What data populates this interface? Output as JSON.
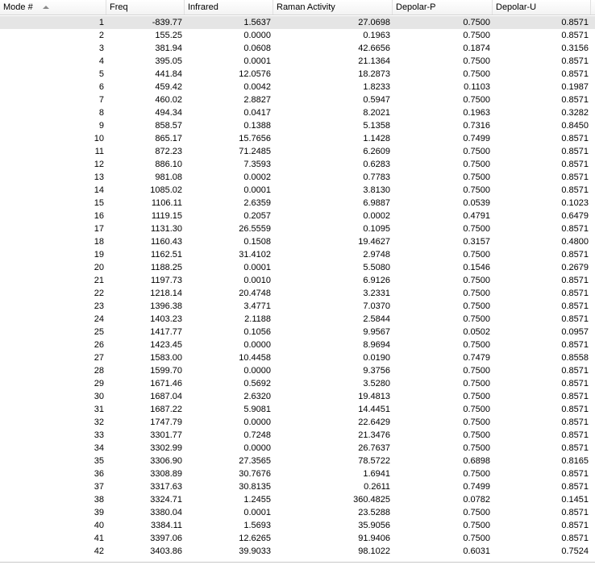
{
  "columns": [
    "Mode #",
    "Freq",
    "Infrared",
    "Raman Activity",
    "Depolar-P",
    "Depolar-U"
  ],
  "sort": {
    "column": "Mode #",
    "direction": "ascending",
    "icon": "sort-ascending-icon"
  },
  "rows": [
    [
      "1",
      "-839.77",
      "1.5637",
      "27.0698",
      "0.7500",
      "0.8571"
    ],
    [
      "2",
      "155.25",
      "0.0000",
      "0.1963",
      "0.7500",
      "0.8571"
    ],
    [
      "3",
      "381.94",
      "0.0608",
      "42.6656",
      "0.1874",
      "0.3156"
    ],
    [
      "4",
      "395.05",
      "0.0001",
      "21.1364",
      "0.7500",
      "0.8571"
    ],
    [
      "5",
      "441.84",
      "12.0576",
      "18.2873",
      "0.7500",
      "0.8571"
    ],
    [
      "6",
      "459.42",
      "0.0042",
      "1.8233",
      "0.1103",
      "0.1987"
    ],
    [
      "7",
      "460.02",
      "2.8827",
      "0.5947",
      "0.7500",
      "0.8571"
    ],
    [
      "8",
      "494.34",
      "0.0417",
      "8.2021",
      "0.1963",
      "0.3282"
    ],
    [
      "9",
      "858.57",
      "0.1388",
      "5.1358",
      "0.7316",
      "0.8450"
    ],
    [
      "10",
      "865.17",
      "15.7656",
      "1.1428",
      "0.7499",
      "0.8571"
    ],
    [
      "11",
      "872.23",
      "71.2485",
      "6.2609",
      "0.7500",
      "0.8571"
    ],
    [
      "12",
      "886.10",
      "7.3593",
      "0.6283",
      "0.7500",
      "0.8571"
    ],
    [
      "13",
      "981.08",
      "0.0002",
      "0.7783",
      "0.7500",
      "0.8571"
    ],
    [
      "14",
      "1085.02",
      "0.0001",
      "3.8130",
      "0.7500",
      "0.8571"
    ],
    [
      "15",
      "1106.11",
      "2.6359",
      "6.9887",
      "0.0539",
      "0.1023"
    ],
    [
      "16",
      "1119.15",
      "0.2057",
      "0.0002",
      "0.4791",
      "0.6479"
    ],
    [
      "17",
      "1131.30",
      "26.5559",
      "0.1095",
      "0.7500",
      "0.8571"
    ],
    [
      "18",
      "1160.43",
      "0.1508",
      "19.4627",
      "0.3157",
      "0.4800"
    ],
    [
      "19",
      "1162.51",
      "31.4102",
      "2.9748",
      "0.7500",
      "0.8571"
    ],
    [
      "20",
      "1188.25",
      "0.0001",
      "5.5080",
      "0.1546",
      "0.2679"
    ],
    [
      "21",
      "1197.73",
      "0.0010",
      "6.9126",
      "0.7500",
      "0.8571"
    ],
    [
      "22",
      "1218.14",
      "20.4748",
      "3.2331",
      "0.7500",
      "0.8571"
    ],
    [
      "23",
      "1396.38",
      "3.4771",
      "7.0370",
      "0.7500",
      "0.8571"
    ],
    [
      "24",
      "1403.23",
      "2.1188",
      "2.5844",
      "0.7500",
      "0.8571"
    ],
    [
      "25",
      "1417.77",
      "0.1056",
      "9.9567",
      "0.0502",
      "0.0957"
    ],
    [
      "26",
      "1423.45",
      "0.0000",
      "8.9694",
      "0.7500",
      "0.8571"
    ],
    [
      "27",
      "1583.00",
      "10.4458",
      "0.0190",
      "0.7479",
      "0.8558"
    ],
    [
      "28",
      "1599.70",
      "0.0000",
      "9.3756",
      "0.7500",
      "0.8571"
    ],
    [
      "29",
      "1671.46",
      "0.5692",
      "3.5280",
      "0.7500",
      "0.8571"
    ],
    [
      "30",
      "1687.04",
      "2.6320",
      "19.4813",
      "0.7500",
      "0.8571"
    ],
    [
      "31",
      "1687.22",
      "5.9081",
      "14.4451",
      "0.7500",
      "0.8571"
    ],
    [
      "32",
      "1747.79",
      "0.0000",
      "22.6429",
      "0.7500",
      "0.8571"
    ],
    [
      "33",
      "3301.77",
      "0.7248",
      "21.3476",
      "0.7500",
      "0.8571"
    ],
    [
      "34",
      "3302.99",
      "0.0000",
      "26.7637",
      "0.7500",
      "0.8571"
    ],
    [
      "35",
      "3306.90",
      "27.3565",
      "78.5722",
      "0.6898",
      "0.8165"
    ],
    [
      "36",
      "3308.89",
      "30.7676",
      "1.6941",
      "0.7500",
      "0.8571"
    ],
    [
      "37",
      "3317.63",
      "30.8135",
      "0.2611",
      "0.7499",
      "0.8571"
    ],
    [
      "38",
      "3324.71",
      "1.2455",
      "360.4825",
      "0.0782",
      "0.1451"
    ],
    [
      "39",
      "3380.04",
      "0.0001",
      "23.5288",
      "0.7500",
      "0.8571"
    ],
    [
      "40",
      "3384.11",
      "1.5693",
      "35.9056",
      "0.7500",
      "0.8571"
    ],
    [
      "41",
      "3397.06",
      "12.6265",
      "91.9406",
      "0.7500",
      "0.8571"
    ],
    [
      "42",
      "3403.86",
      "39.9033",
      "98.1022",
      "0.6031",
      "0.7524"
    ]
  ]
}
